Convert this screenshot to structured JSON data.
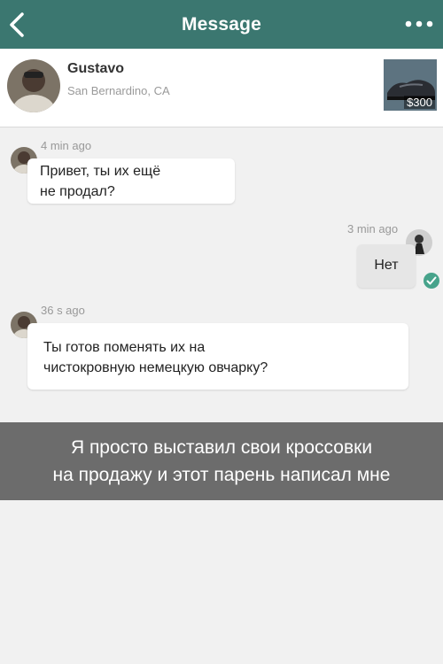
{
  "nav": {
    "title": "Message",
    "back_icon": "chevron-left-icon",
    "more_icon": "more-dots-icon",
    "bg_color": "#3b7770"
  },
  "seller": {
    "name": "Gustavo",
    "location": "San Bernardino, CA"
  },
  "product": {
    "price": "$300"
  },
  "messages": [
    {
      "direction": "incoming",
      "time": "4 min ago",
      "text": "Привет, ты их ещё\nне продал?"
    },
    {
      "direction": "outgoing",
      "time": "3 min ago",
      "text": "Нет",
      "status": "read"
    },
    {
      "direction": "incoming",
      "time": "36 s ago",
      "text": "Ты готов поменять их на\nчистокровную немецкую овчарку?"
    }
  ],
  "caption": "Я просто выставил свои кроссовки\nна продажу и этот парень написал мне"
}
